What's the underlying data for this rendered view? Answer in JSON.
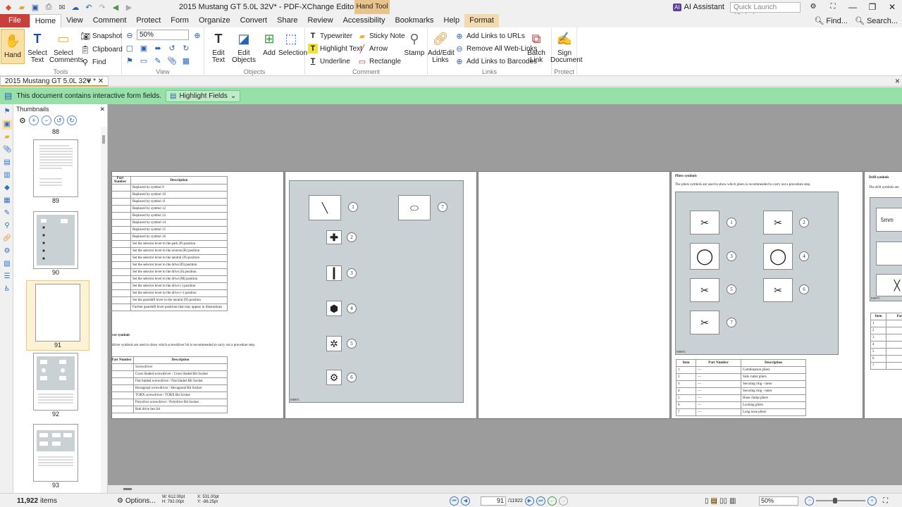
{
  "window": {
    "title": "2015 Mustang GT 5.0L 32V* - PDF-XChange Editor",
    "context_tab_group": "Hand Tool",
    "ai_assistant": "AI Assistant",
    "ai_badge": "AI",
    "quick_launch_placeholder": "Quick Launch (Ctrl+.)",
    "controls": [
      "—",
      "❐",
      "✕"
    ]
  },
  "menu": {
    "tabs": [
      "File",
      "Home",
      "View",
      "Comment",
      "Protect",
      "Form",
      "Organize",
      "Convert",
      "Share",
      "Review",
      "Accessibility",
      "Bookmarks",
      "Help",
      "Format"
    ],
    "active": "Home",
    "find": "Find...",
    "search": "Search..."
  },
  "ribbon": {
    "tools": {
      "hand": "Hand",
      "select_text": "Select\nText",
      "select_comments": "Select\nComments",
      "label": "Tools"
    },
    "snapshot": "Snapshot",
    "clipboard": "Clipboard",
    "find": "Find",
    "zoom": "50%",
    "view_label": "View",
    "objects": {
      "edit_text": "Edit\nText",
      "edit_objects": "Edit\nObjects",
      "add": "Add",
      "selection": "Selection",
      "label": "Objects"
    },
    "comment": {
      "typewriter": "Typewriter",
      "highlight": "Highlight Text",
      "underline": "Underline",
      "sticky": "Sticky Note",
      "arrow": "Arrow",
      "rectangle": "Rectangle",
      "stamp": "Stamp",
      "label": "Comment"
    },
    "links": {
      "add_edit": "Add/Edit\nLinks",
      "add_links_urls": "Add Links to URLs",
      "remove_links": "Remove All Web-Links",
      "add_barcodes": "Add Links to Barcodes",
      "batch_link": "Batch\nLink",
      "label": "Links"
    },
    "protect": {
      "sign": "Sign\nDocument",
      "label": "Protect"
    }
  },
  "doc_tab": {
    "name": "2015 Mustang GT 5.0L 32V *",
    "close": "×"
  },
  "notification": {
    "text": "This document contains interactive form fields.",
    "button": "Highlight Fields"
  },
  "thumbnails": {
    "title": "Thumbnails",
    "zoom_buttons": [
      "+",
      "−"
    ],
    "pages": [
      {
        "label": "88"
      },
      {
        "label": "89"
      },
      {
        "label": "90"
      },
      {
        "label": "91",
        "selected": true
      },
      {
        "label": "92"
      },
      {
        "label": "93"
      }
    ],
    "count": "11,922",
    "count_suffix": "items"
  },
  "page1": {
    "header": [
      "Part\nNumber",
      "Description"
    ],
    "rows": [
      "Replaced by symbol 9",
      "Replaced by symbol 10",
      "Replaced by symbol 11",
      "Replaced by symbol 12",
      "Replaced by symbol 12",
      "Replaced by symbol 14",
      "Replaced by symbol 15",
      "Replaced by symbol 16",
      "Set the selector lever to the park (P) position",
      "Set the selector lever to the reverse (R) position",
      "Set the selector lever to the neutral (N) position",
      "Set the selector lever to the drive (D) position",
      "Set the selector lever to the drive (S) position",
      "Set the selector lever to the drive (M) position",
      "Set the selector lever to the drive (-) position",
      "Set the selector lever to the drive (+) position",
      "Set the gearshift lever to the neutral (N) position",
      "Further gearshift lever positions that may appear in illustrations"
    ],
    "section_title": "ver symbols",
    "section_text": "driver symbols are used to show which screwdriver bit is recommended to carry out a procedure step.",
    "table2_header": [
      "Part Number",
      "Description"
    ],
    "table2_rows": [
      "Screwdriver",
      "Cross bladed screwdriver / Cross bladed Bit Socket",
      "Flat bladed screwdriver / Flat bladed Bit Socket",
      "Hexagonal screwdriver / Hexagonal Bit Socket",
      "TORX screwdriver / TORX Bit Socket",
      "Polydrive screwdriver / Polydrive Bit Socket",
      "Bolt drive hex bit"
    ]
  },
  "page2": {
    "numbers": [
      "1",
      "2",
      "3",
      "4",
      "5",
      "6",
      "7"
    ],
    "caption": "E88873"
  },
  "page4": {
    "title": "Pliers symbols",
    "intro": "The pliers symbols are used to show which pliers is recommended to carry out a procedure step.",
    "numbers": [
      "1",
      "2",
      "3",
      "4",
      "5",
      "6",
      "7"
    ],
    "caption": "E88874",
    "table_header": [
      "Item",
      "Part Number",
      "Description"
    ],
    "rows": [
      [
        "1",
        "—",
        "Combination pliers"
      ],
      [
        "2",
        "—",
        "Side cutter pliers"
      ],
      [
        "3",
        "—",
        "Securing ring - inner"
      ],
      [
        "4",
        "—",
        "Securing ring - outer"
      ],
      [
        "5",
        "—",
        "Hose clamp pliers"
      ],
      [
        "6",
        "—",
        "Locking pliers"
      ],
      [
        "7",
        "—",
        "Long nose pliers"
      ]
    ]
  },
  "page5": {
    "title": "Drill symbols",
    "intro": "The drill symbols are",
    "fig_text": "5mm",
    "fig_text2": "M",
    "caption": "E88875",
    "table_header": [
      "Item",
      "Part Nu"
    ],
    "items": [
      "1",
      "2",
      "3",
      "4",
      "5",
      "6",
      "7"
    ]
  },
  "status": {
    "options": "Options...",
    "w": "W: 612.00pt",
    "h": "H: 792.00pt",
    "x": "X: 531.00pt",
    "y": "Y: -86.25pt",
    "page": "91",
    "total": "11922",
    "zoom": "50%"
  },
  "colors": {
    "file_tab": "#c9403a",
    "notify": "#98e0aa",
    "selected": "#fbe0a6",
    "docbg": "#9c9c9c"
  }
}
